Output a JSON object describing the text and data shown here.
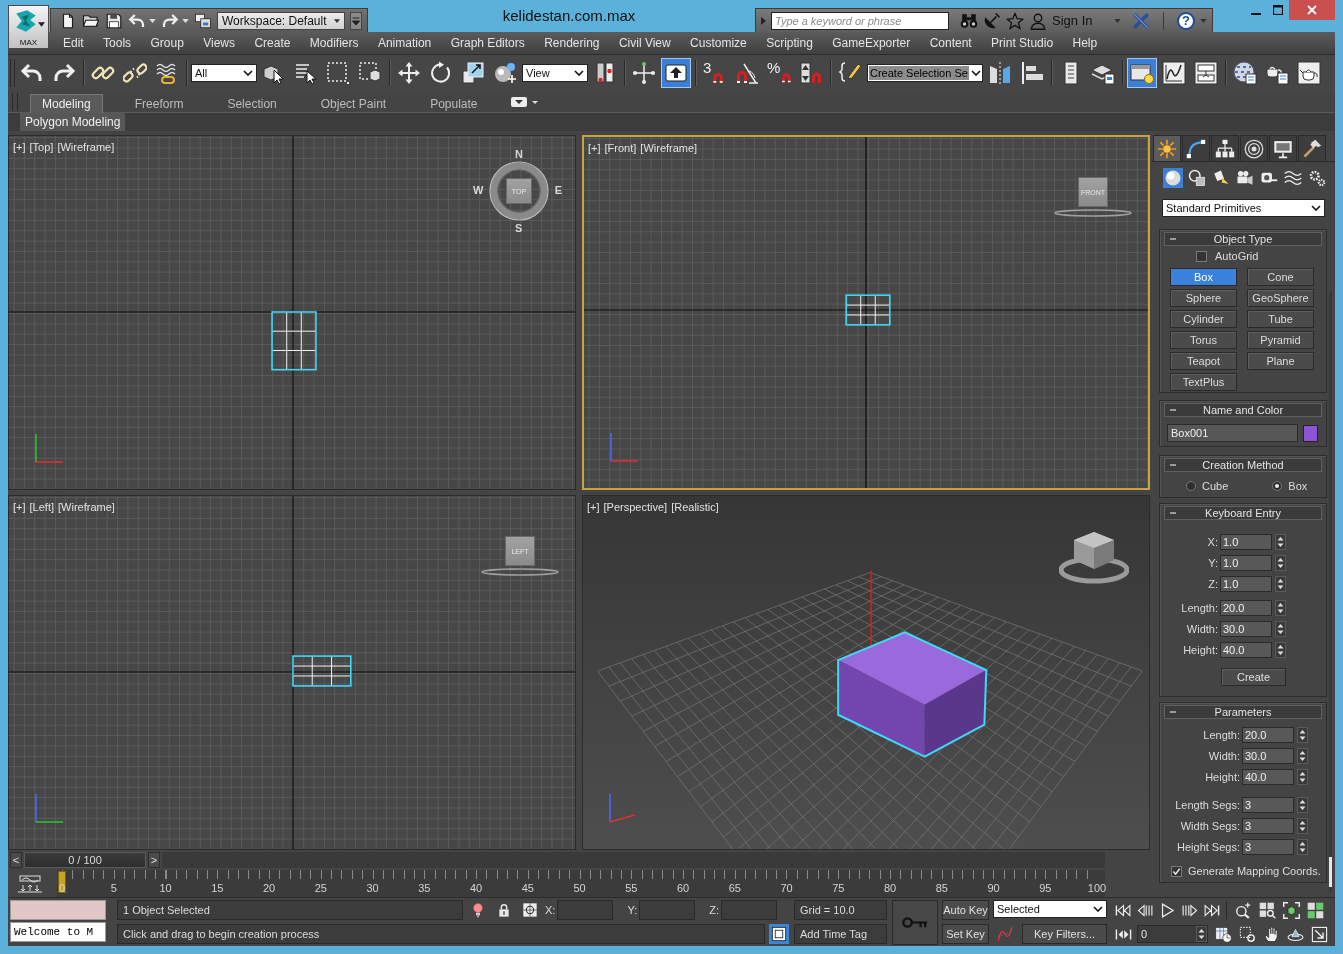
{
  "window": {
    "title": "kelidestan.com.max",
    "controls": [
      {
        "kind": "minimize"
      },
      {
        "kind": "maximize"
      },
      {
        "kind": "close"
      }
    ]
  },
  "app_button": {
    "label": "MAX"
  },
  "quick_access": {
    "tools": [
      {
        "kind": "new",
        "menu": false
      },
      {
        "kind": "open",
        "menu": false
      },
      {
        "kind": "save",
        "menu": false
      },
      {
        "kind": "undo",
        "menu": true
      },
      {
        "kind": "redo",
        "menu": true
      },
      {
        "kind": "project",
        "menu": false
      }
    ],
    "workspace": "Workspace: Default"
  },
  "infocenter": {
    "placeholder": "Type a keyword or phrase",
    "tools": [
      {
        "kind": "binoculars"
      },
      {
        "kind": "satellite"
      },
      {
        "kind": "star"
      }
    ],
    "sign_in": "Sign In",
    "help": "?"
  },
  "menu": [
    "Edit",
    "Tools",
    "Group",
    "Views",
    "Create",
    "Modifiers",
    "Animation",
    "Graph Editors",
    "Rendering",
    "Civil View",
    "Customize",
    "Scripting",
    "GameExporter",
    "Content",
    "Print Studio",
    "Help"
  ],
  "main_toolbar": [
    [
      {
        "kind": "undo",
        "on": false
      },
      {
        "kind": "redo",
        "on": false
      }
    ],
    [
      {
        "kind": "link",
        "on": false
      },
      {
        "kind": "unlink",
        "on": false
      },
      {
        "kind": "bind",
        "on": false
      }
    ],
    [
      {
        "kind": "dropdown",
        "value": "All"
      },
      {
        "kind": "select",
        "on": false
      },
      {
        "kind": "select_by_name",
        "on": false
      },
      {
        "kind": "rect_region",
        "on": false
      },
      {
        "kind": "window_crossing",
        "on": false
      }
    ],
    [
      {
        "kind": "move",
        "on": false
      },
      {
        "kind": "rotate",
        "on": false
      },
      {
        "kind": "scale",
        "on": false
      },
      {
        "kind": "place",
        "on": false
      },
      {
        "kind": "dropdown",
        "value": "View"
      },
      {
        "kind": "pivot",
        "on": false
      }
    ],
    [
      {
        "kind": "manipulate",
        "on": false
      },
      {
        "kind": "keyboard_override",
        "on": true
      }
    ],
    [
      {
        "kind": "snap",
        "label": "3",
        "on": false
      },
      {
        "kind": "angle_snap",
        "on": false
      },
      {
        "kind": "percent_snap",
        "label": "%",
        "on": false
      },
      {
        "kind": "spinner_snap",
        "on": false
      }
    ],
    [
      {
        "kind": "named_sets",
        "on": false
      },
      {
        "kind": "combo",
        "value": "Create Selection Se"
      },
      {
        "kind": "mirror",
        "on": false
      },
      {
        "kind": "align",
        "on": false
      }
    ],
    [
      {
        "kind": "scene_explorer",
        "on": false
      },
      {
        "kind": "layer_explorer",
        "on": false
      }
    ],
    [
      {
        "kind": "ribbon",
        "on": true
      },
      {
        "kind": "curve_editor",
        "on": false
      },
      {
        "kind": "schematic",
        "on": false
      }
    ],
    [
      {
        "kind": "material_editor",
        "on": false
      },
      {
        "kind": "render_setup",
        "on": false
      },
      {
        "kind": "render",
        "on": false
      }
    ]
  ],
  "ribbon": {
    "tabs": [
      {
        "label": "Modeling",
        "selected": true
      },
      {
        "label": "Freeform",
        "selected": false
      },
      {
        "label": "Selection",
        "selected": false
      },
      {
        "label": "Object Paint",
        "selected": false
      },
      {
        "label": "Populate",
        "selected": false
      }
    ],
    "panel": "Polygon Modeling"
  },
  "viewports": [
    {
      "kind": "top",
      "labels": [
        "[+]",
        "[Top]",
        "[Wireframe]"
      ],
      "active": false,
      "viewcube": {
        "face": "TOP",
        "compass": [
          "N",
          "E",
          "S",
          "W"
        ]
      }
    },
    {
      "kind": "front",
      "labels": [
        "[+]",
        "[Front]",
        "[Wireframe]"
      ],
      "active": true,
      "viewcube": {
        "face": "FRONT"
      }
    },
    {
      "kind": "left",
      "labels": [
        "[+]",
        "[Left]",
        "[Wireframe]"
      ],
      "active": false,
      "viewcube": {
        "face": "LEFT"
      }
    },
    {
      "kind": "perspective",
      "labels": [
        "[+]",
        "[Perspective]",
        "[Realistic]"
      ],
      "active": false
    }
  ],
  "time_slider": {
    "prev": "<",
    "position": "0 / 100",
    "next": ">",
    "level": 0
  },
  "track_bar": {
    "ticks": [
      "0",
      "5",
      "10",
      "15",
      "20",
      "25",
      "30",
      "35",
      "40",
      "45",
      "50",
      "55",
      "60",
      "65",
      "70",
      "75",
      "80",
      "85",
      "90",
      "95",
      "100"
    ]
  },
  "command_panel": {
    "tabs": [
      {
        "kind": "create",
        "selected": true
      },
      {
        "kind": "modify",
        "selected": false
      },
      {
        "kind": "hierarchy",
        "selected": false
      },
      {
        "kind": "motion",
        "selected": false
      },
      {
        "kind": "display",
        "selected": false
      },
      {
        "kind": "utilities",
        "selected": false
      }
    ],
    "categories": [
      {
        "kind": "geometry",
        "selected": true
      },
      {
        "kind": "shapes",
        "selected": false
      },
      {
        "kind": "lights",
        "selected": false
      },
      {
        "kind": "cameras",
        "selected": false
      },
      {
        "kind": "helpers",
        "selected": false
      },
      {
        "kind": "space_warps",
        "selected": false
      },
      {
        "kind": "systems",
        "selected": false
      }
    ],
    "subcategory": "Standard Primitives",
    "rollouts": [
      {
        "kind": "object_type",
        "title": "Object Type",
        "expanded": true,
        "autogrid": {
          "label": "AutoGrid",
          "checked": false
        },
        "buttons": [
          {
            "label": "Box",
            "selected": true
          },
          {
            "label": "Cone",
            "selected": false
          },
          {
            "label": "Sphere",
            "selected": false
          },
          {
            "label": "GeoSphere",
            "selected": false
          },
          {
            "label": "Cylinder",
            "selected": false
          },
          {
            "label": "Tube",
            "selected": false
          },
          {
            "label": "Torus",
            "selected": false
          },
          {
            "label": "Pyramid",
            "selected": false
          },
          {
            "label": "Teapot",
            "selected": false
          },
          {
            "label": "Plane",
            "selected": false
          },
          {
            "label": "TextPlus",
            "selected": false
          }
        ]
      },
      {
        "kind": "name_color",
        "title": "Name and Color",
        "expanded": true,
        "name": "Box001",
        "color": "#8d55d6"
      },
      {
        "kind": "creation_method",
        "title": "Creation Method",
        "expanded": true,
        "options": [
          {
            "label": "Cube",
            "selected": false
          },
          {
            "label": "Box",
            "selected": true
          }
        ]
      },
      {
        "kind": "keyboard_entry",
        "title": "Keyboard Entry",
        "expanded": true,
        "groups": [
          [
            {
              "label": "X:",
              "value": "1.0"
            },
            {
              "label": "Y:",
              "value": "1.0"
            },
            {
              "label": "Z:",
              "value": "1.0"
            }
          ],
          [
            {
              "label": "Length:",
              "value": "20.0"
            },
            {
              "label": "Width:",
              "value": "30.0"
            },
            {
              "label": "Height:",
              "value": "40.0"
            }
          ]
        ],
        "button": "Create"
      },
      {
        "kind": "parameters",
        "title": "Parameters",
        "expanded": true,
        "groups": [
          [
            {
              "label": "Length:",
              "value": "20.0"
            },
            {
              "label": "Width:",
              "value": "30.0"
            },
            {
              "label": "Height:",
              "value": "40.0"
            }
          ],
          [
            {
              "label": "Length Segs:",
              "value": "3"
            },
            {
              "label": "Width Segs:",
              "value": "3"
            },
            {
              "label": "Height Segs:",
              "value": "3"
            }
          ]
        ],
        "checkbox": {
          "label": "Generate Mapping Coords.",
          "checked": true
        }
      }
    ]
  },
  "status_bar": {
    "listener": {
      "output": "Welcome to M"
    },
    "prompt": "1 Object Selected",
    "hint": "Click and drag to begin creation process",
    "tools": [
      {
        "kind": "isolate"
      },
      {
        "kind": "lock"
      },
      {
        "kind": "absolute"
      }
    ],
    "coords": [
      "X:",
      "Y:",
      "Z:"
    ],
    "grid": "Grid = 10.0",
    "time_tag": "Add Time Tag",
    "auto_key": {
      "label": "Auto Key",
      "on": false
    },
    "set_key": "Set Key",
    "key_set": "Selected",
    "key_filters": "Key Filters...",
    "playback": [
      {
        "kind": "start"
      },
      {
        "kind": "prev"
      },
      {
        "kind": "play"
      },
      {
        "kind": "next"
      },
      {
        "kind": "end"
      }
    ],
    "frame": "0",
    "time_tools": [
      {
        "kind": "key_mode"
      },
      {
        "kind": "time_config"
      }
    ],
    "nav": [
      {
        "kind": "zoom"
      },
      {
        "kind": "zoom_all"
      },
      {
        "kind": "zoom_extents"
      },
      {
        "kind": "zoom_extents_all"
      },
      {
        "kind": "region_zoom"
      },
      {
        "kind": "pan"
      },
      {
        "kind": "orbit"
      },
      {
        "kind": "maximize"
      }
    ]
  }
}
